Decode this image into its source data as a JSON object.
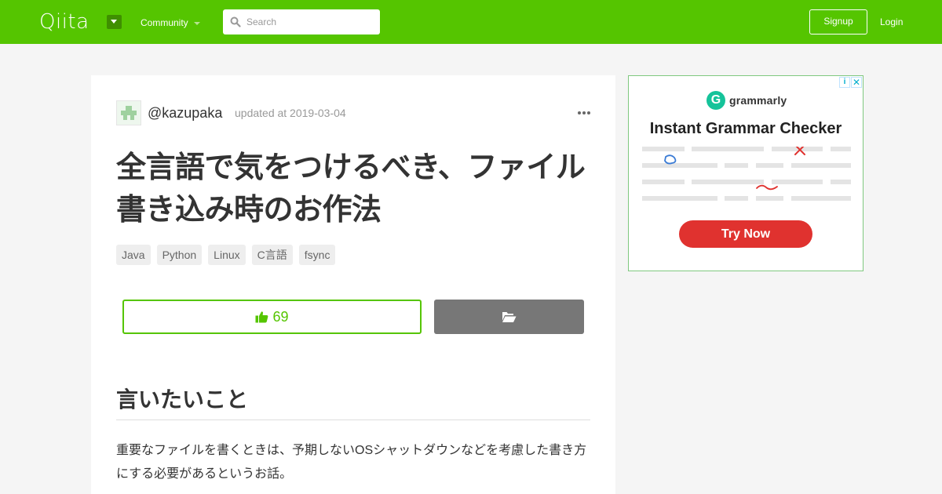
{
  "header": {
    "logo": "Qiita",
    "community_label": "Community",
    "search_placeholder": "Search",
    "signup_label": "Signup",
    "login_label": "Login",
    "brand_color": "#55c500"
  },
  "article": {
    "author": "@kazupaka",
    "updated": "updated at 2019-03-04",
    "title": "全言語で気をつけるべき、ファイル書き込み時のお作法",
    "tags": [
      "Java",
      "Python",
      "Linux",
      "C言語",
      "fsync"
    ],
    "like_count": "69",
    "section_heading": "言いたいこと",
    "body": "重要なファイルを書くときは、予期しないOSシャットダウンなどを考慮した書き方にする必要があるというお話。"
  },
  "ad": {
    "brand": "grammarly",
    "logo_letter": "G",
    "headline": "Instant Grammar Checker",
    "cta": "Try Now",
    "info_icon": "i",
    "close_icon": "✕",
    "cta_color": "#e0322f"
  }
}
